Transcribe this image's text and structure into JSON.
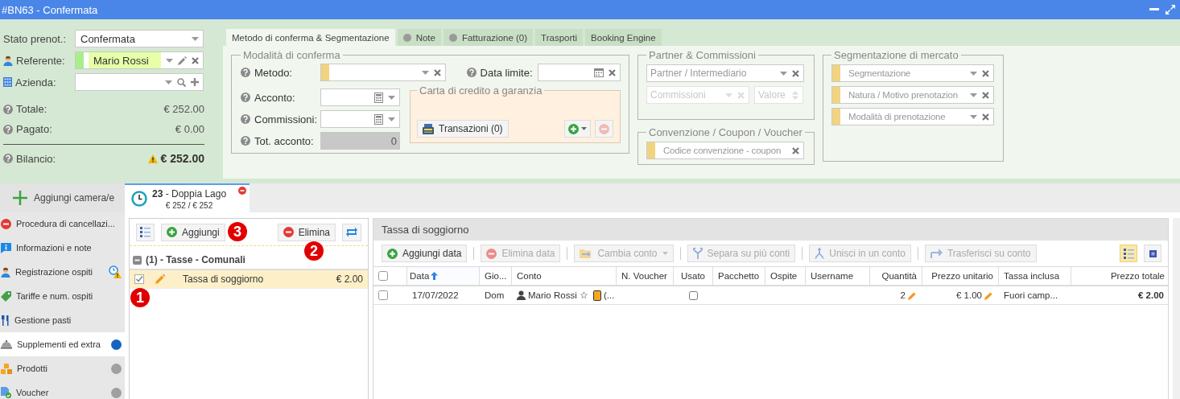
{
  "window": {
    "title": "#BN63 - Confermata"
  },
  "summary": {
    "fields": [
      {
        "kind": "select",
        "label": "Stato prenot.:",
        "value": "Confermata"
      },
      {
        "kind": "person",
        "label": "Referente:",
        "value": "Mario Rossi"
      },
      {
        "kind": "company",
        "label": "Azienda:"
      }
    ],
    "totals": [
      {
        "kind": "amount",
        "label": "Totale:",
        "value": "€ 252.00",
        "warning": false
      },
      {
        "kind": "amount",
        "label": "Pagato:",
        "value": "€ 0.00",
        "warning": false
      },
      {
        "kind": "balance",
        "label": "Bilancio:",
        "value": "€ 252.00",
        "warning": true
      }
    ]
  },
  "tabs": [
    {
      "label": "Metodo di conferma & Segmentazione",
      "selected": true,
      "dot": false
    },
    {
      "label": "Note",
      "selected": false,
      "dot": true
    },
    {
      "label": "Fatturazione (0)",
      "selected": false,
      "dot": true
    },
    {
      "label": "Trasporti",
      "selected": false,
      "dot": false
    },
    {
      "label": "Booking Engine",
      "selected": false,
      "dot": false
    }
  ],
  "confirmation": {
    "title": "Modalità di conferma",
    "method_label": "Metodo:",
    "deadline_label": "Data limite:",
    "deposit_label": "Acconto:",
    "commission_label": "Commissioni:",
    "total_deposit_label": "Tot. acconto:",
    "total_deposit_value": "0",
    "card": {
      "title": "Carta di credito a garanzia",
      "transactions_button": "Transazioni (0)"
    }
  },
  "partner": {
    "title": "Partner & Commissioni",
    "partner_placeholder": "Partner / Intermediario",
    "commission_placeholder": "Commissioni",
    "value_placeholder": "Valore"
  },
  "convention": {
    "title": "Convenzione / Coupon / Voucher",
    "code_placeholder": "Codice convenzione - coupon"
  },
  "segmentation": {
    "title": "Segmentazione di mercato",
    "fields": [
      {
        "placeholder": "Segmentazione"
      },
      {
        "placeholder": "Natura / Motivo prenotazion"
      },
      {
        "placeholder": "Modalità di prenotazione"
      }
    ]
  },
  "sidebar": {
    "add_button": "Aggiungi camera/e",
    "items": [
      {
        "kind": "cancel",
        "label": "Procedura di cancellazi...",
        "selected": false,
        "warning": false
      },
      {
        "kind": "info",
        "label": "Informazioni e note",
        "selected": false,
        "warning": false
      },
      {
        "kind": "person",
        "label": "Registrazione ospiti",
        "selected": false,
        "warning": true
      },
      {
        "kind": "tag",
        "label": "Tariffe e num. ospiti",
        "selected": false,
        "warning": false
      },
      {
        "kind": "cutlery",
        "label": "Gestione pasti",
        "selected": false,
        "warning": false
      },
      {
        "kind": "bell",
        "label": "Supplementi ed extra",
        "selected": true,
        "warning": false,
        "color": "#1565c0"
      },
      {
        "kind": "boxes",
        "label": "Prodotti",
        "selected": false,
        "warning": false,
        "color": "#a0a0a0"
      },
      {
        "kind": "voucher",
        "label": "Voucher",
        "selected": false,
        "warning": false,
        "color": "#a0a0a0"
      }
    ]
  },
  "room_tab": {
    "title": "**23** - Doppia Lago",
    "amount": "€ 252 / € 252",
    "selected": true
  },
  "extras": {
    "add_button": "Aggiungi",
    "delete_button": "Elimina",
    "groups": [
      {
        "title": "(1) - Tasse - Comunali",
        "expanded": true,
        "items": [
          {
            "name": "Tassa di soggiorno",
            "price": "€ 2.00",
            "checked": true,
            "selected": true
          }
        ]
      }
    ]
  },
  "detail": {
    "title": "Tassa di soggiorno",
    "toolbar": [
      {
        "kind": "add",
        "label": "Aggiungi data",
        "disabled": false,
        "dropdown": false
      },
      {
        "kind": "remove",
        "label": "Elimina data",
        "disabled": true,
        "dropdown": false
      },
      {
        "kind": "folder",
        "label": "Cambia conto",
        "disabled": true,
        "dropdown": true
      },
      {
        "kind": "split",
        "label": "Separa su più conti",
        "disabled": true,
        "dropdown": false
      },
      {
        "kind": "merge",
        "label": "Unisci in un conto",
        "disabled": true,
        "dropdown": false
      },
      {
        "kind": "transfer",
        "label": "Trasferisci su conto",
        "disabled": true,
        "dropdown": false
      }
    ],
    "view_toggles": [
      {
        "kind": "list",
        "selected": true
      },
      {
        "kind": "compact",
        "selected": false
      }
    ],
    "columns": [
      {
        "label": "Data",
        "sorted": true
      },
      {
        "label": "Gio...",
        "sorted": false
      },
      {
        "label": "Conto",
        "sorted": false
      },
      {
        "label": "N. Voucher",
        "sorted": false
      },
      {
        "label": "Usato",
        "sorted": false
      },
      {
        "label": "Pacchetto",
        "sorted": false
      },
      {
        "label": "Ospite",
        "sorted": false
      },
      {
        "label": "Username",
        "sorted": false
      },
      {
        "label": "Quantità",
        "sorted": false
      },
      {
        "label": "Prezzo unitario",
        "sorted": false
      },
      {
        "label": "Tassa inclusa",
        "sorted": false
      },
      {
        "label": "Prezzo totale",
        "sorted": false
      }
    ],
    "all_checked": false,
    "rows": [
      {
        "checked": false,
        "date": "17/07/2022",
        "day": "Dom",
        "account": "Mario Rossi ☆",
        "account_more": "(...",
        "used": false,
        "quantity": "2",
        "unit_price": "€ 1.00",
        "tax_included": "Fuori camp...",
        "total_price": "€ 2.00"
      }
    ]
  },
  "annotations": [
    {
      "label": "1"
    },
    {
      "label": "2"
    },
    {
      "label": "3"
    }
  ]
}
